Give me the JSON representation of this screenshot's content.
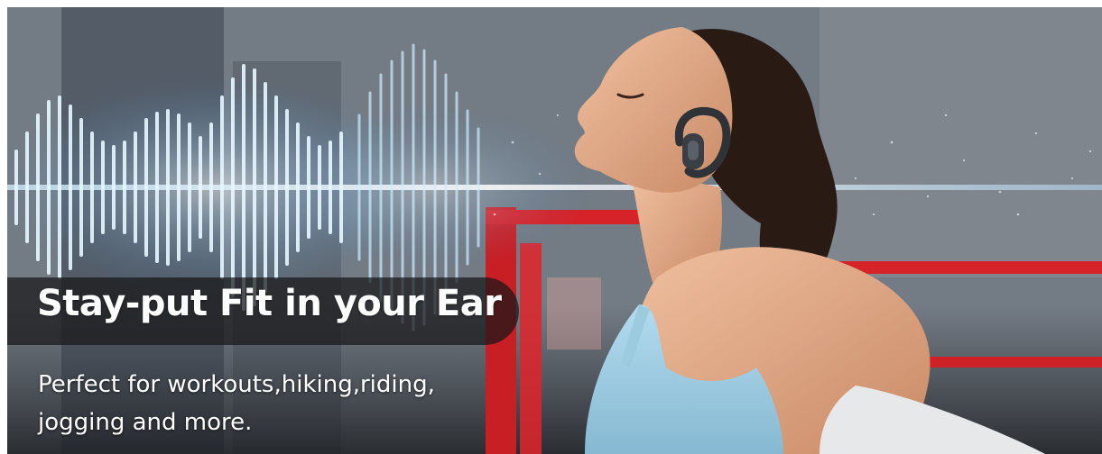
{
  "banner": {
    "headline": "Stay-put Fit in your Ear",
    "subtext": "Perfect for workouts,hiking,riding, jogging and more."
  },
  "scene": {
    "photo": "woman-wearing-open-ear-sport-headphones",
    "effect": "sound-wave-glow"
  },
  "colors": {
    "wave_glow": "#9fd8ff",
    "ring_red": "#e0242c",
    "top_fabric": "#9ecbe0",
    "skin": "#e3ad8c",
    "hair": "#2a1a14",
    "headline_bar": "#161618"
  }
}
